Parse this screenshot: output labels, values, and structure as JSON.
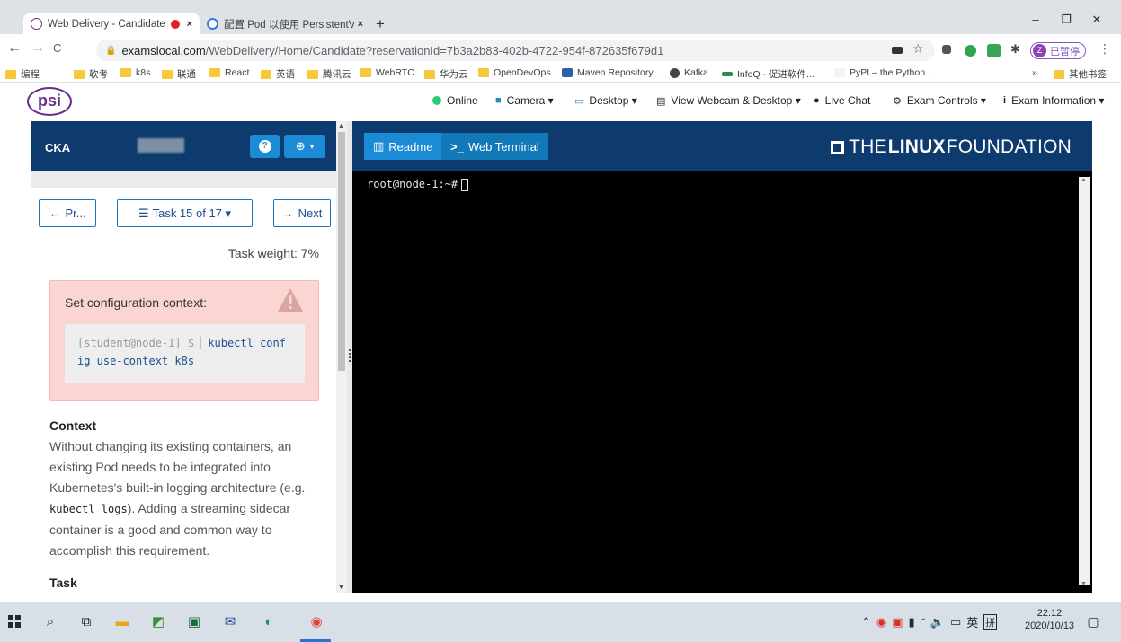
{
  "browser": {
    "tabs": [
      {
        "title": "Web Delivery - Candidate",
        "active": true,
        "recording": true,
        "close": "×"
      },
      {
        "title": "配置 Pod 以使用 PersistentVolu",
        "active": false,
        "close": "×"
      }
    ],
    "new_tab": "+",
    "window_controls": {
      "minimize": "–",
      "restore": "❐",
      "close": "✕"
    },
    "nav": {
      "back": "←",
      "forward": "→",
      "reload": "C"
    },
    "url": {
      "host": "examslocal.com",
      "path": "/WebDelivery/Home/Candidate?reservationId=7b3a2b83-402b-4722-954f-872635f679d1"
    },
    "profile": {
      "initial": "Z",
      "label": "已暂停"
    },
    "menu": "⋮",
    "bookmarks": [
      "编程",
      "软考",
      "k8s",
      "联通",
      "React",
      "英语",
      "腾讯云",
      "WebRTC",
      "华为云",
      "OpenDevOps",
      "Maven Repository...",
      "Kafka",
      "InfoQ - 促进软件...",
      "PyPI – the Python..."
    ],
    "bookmarks_overflow": "»",
    "other_bookmarks": "其他书签"
  },
  "psi_header": {
    "logo": "psi",
    "items": [
      {
        "label": "Online"
      },
      {
        "label": "Camera ▾"
      },
      {
        "label": "Desktop ▾"
      },
      {
        "label": "View Webcam & Desktop ▾"
      },
      {
        "label": "Live Chat"
      },
      {
        "label": "Exam Controls ▾"
      },
      {
        "label": "Exam Information ▾"
      }
    ]
  },
  "left_panel": {
    "exam_title": "CKA",
    "help_icon": "?",
    "globe_caret": "▾",
    "prev_label": "Pr...",
    "task_selector": "Task 15 of 17 ▾",
    "next_label": "Next",
    "task_weight": "Task weight: 7%",
    "alert": {
      "title": "Set configuration context:",
      "prompt": "[student@node-1] $",
      "command_line1": "kubectl conf",
      "command_line2": "ig use-context k8s"
    },
    "context_heading": "Context",
    "context_text_1": "Without changing its existing containers, an existing Pod needs to be integrated into Kubernetes's built-in logging architecture (e.g. ",
    "context_code": "kubectl logs",
    "context_text_2": "). Adding a streaming sidecar container is a good and common way to accomplish this requirement.",
    "task_heading": "Task"
  },
  "right_panel": {
    "tab_readme": "Readme",
    "tab_terminal": "Web Terminal",
    "brand_pre": "THE",
    "brand_bold": "LINUX",
    "brand_post": "FOUNDATION",
    "terminal_prompt": "root@node-1:~#"
  },
  "taskbar": {
    "tray_text": "英",
    "ime": "拼",
    "time": "22:12",
    "date": "2020/10/13"
  },
  "colors": {
    "header_navy": "#0d3b6e",
    "button_blue": "#1b8bd6",
    "alert_pink": "#fbd5d2",
    "online_green": "#2ecc71"
  }
}
